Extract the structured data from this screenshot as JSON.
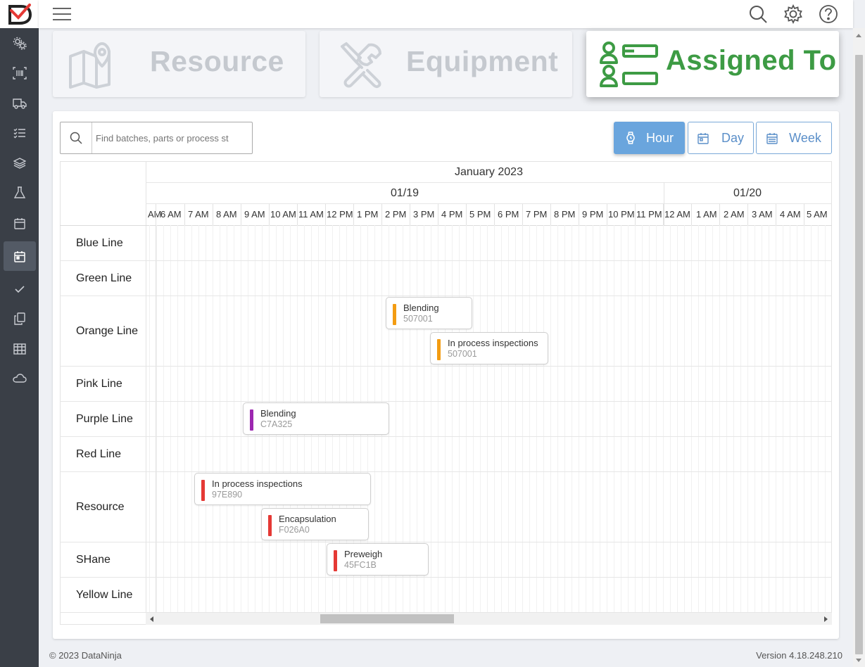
{
  "footer": {
    "copyright": "© 2023 DataNinja",
    "version": "Version 4.18.248.210"
  },
  "cards": [
    {
      "label": "Resource",
      "active": false
    },
    {
      "label": "Equipment",
      "active": false
    },
    {
      "label": "Assigned To",
      "active": true,
      "color": "#3d9b44"
    }
  ],
  "search": {
    "placeholder": "Find batches, parts or process st"
  },
  "view_buttons": [
    {
      "label": "Hour",
      "active": true
    },
    {
      "label": "Day",
      "active": false
    },
    {
      "label": "Week",
      "active": false
    }
  ],
  "timeline": {
    "month": "January 2023",
    "days": [
      "01/19",
      "01/20"
    ],
    "hours": [
      "AM",
      "6 AM",
      "7 AM",
      "8 AM",
      "9 AM",
      "10 AM",
      "11 AM",
      "12 PM",
      "1 PM",
      "2 PM",
      "3 PM",
      "4 PM",
      "5 PM",
      "6 PM",
      "7 PM",
      "8 PM",
      "9 PM",
      "10 PM",
      "11 PM",
      "12 AM",
      "1 AM",
      "2 AM",
      "3 AM",
      "4 AM",
      "5 AM"
    ]
  },
  "rows": [
    "Blue Line",
    "Green Line",
    "Orange Line",
    "Pink Line",
    "Purple Line",
    "Red Line",
    "Resource",
    "SHane",
    "Yellow Line"
  ],
  "events": [
    {
      "title": "Blending",
      "subtitle": "507001",
      "row": "Orange Line",
      "color": "#f39c12"
    },
    {
      "title": "In process inspections",
      "subtitle": "507001",
      "row": "Orange Line",
      "color": "#f39c12"
    },
    {
      "title": "Blending",
      "subtitle": "C7A325",
      "row": "Purple Line",
      "color": "#9c27b0"
    },
    {
      "title": "In process inspections",
      "subtitle": "97E890",
      "row": "Resource",
      "color": "#e53935"
    },
    {
      "title": "Encapsulation",
      "subtitle": "F026A0",
      "row": "Resource",
      "color": "#e53935"
    },
    {
      "title": "Preweigh",
      "subtitle": "45FC1B",
      "row": "SHane",
      "color": "#e53935"
    }
  ]
}
